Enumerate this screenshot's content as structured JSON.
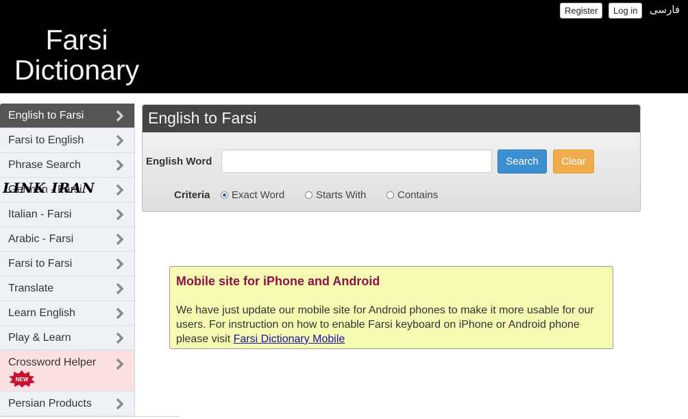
{
  "header": {
    "site_title": "Farsi Dictionary",
    "register_label": "Register",
    "login_label": "Log in",
    "language_link": "فارسی"
  },
  "sidebar": {
    "items": [
      {
        "label": "English to Farsi",
        "active": true
      },
      {
        "label": "Farsi to English"
      },
      {
        "label": "Phrase Search"
      },
      {
        "label": "German - Farsi"
      },
      {
        "label": "Italian - Farsi"
      },
      {
        "label": "Arabic - Farsi"
      },
      {
        "label": "Farsi to Farsi"
      },
      {
        "label": "Translate"
      },
      {
        "label": "Learn English"
      },
      {
        "label": "Play & Learn"
      },
      {
        "label": "Crossword Helper",
        "badge": "NEW"
      },
      {
        "label": "Persian Products"
      }
    ],
    "watermark": "LINK IRAN"
  },
  "search_panel": {
    "title": "English to Farsi",
    "word_label": "English Word",
    "word_value": "",
    "search_label": "Search",
    "clear_label": "Clear",
    "criteria_label": "Criteria",
    "criteria_options": [
      "Exact Word",
      "Starts With",
      "Contains"
    ],
    "criteria_selected": "Exact Word"
  },
  "notice": {
    "title": "Mobile site for iPhone and Android",
    "body": "We have just update our mobile site for Android phones to make it more usable for our users. For instruction on how to enable Farsi keyboard on iPhone or Android phone please visit ",
    "link_text": "Farsi Dictionary Mobile"
  },
  "colors": {
    "header_bg": "#000000",
    "panel_head": "#444444",
    "search_button": "#3e8fcf",
    "clear_button": "#f0ad4e",
    "notice_bg": "#f5f9b2",
    "notice_title": "#8b1446"
  }
}
